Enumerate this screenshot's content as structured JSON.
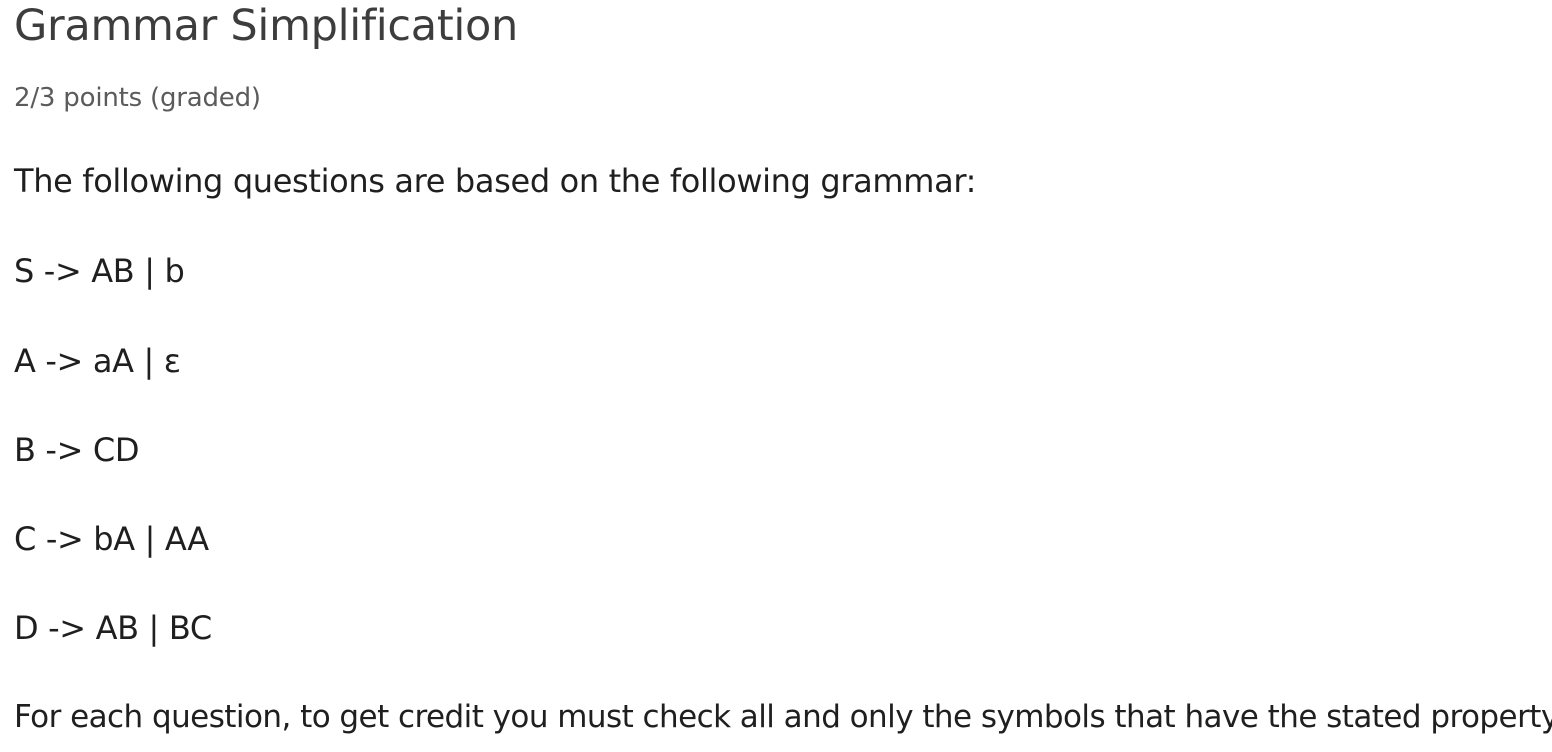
{
  "problem": {
    "title": "Grammar Simplification",
    "points": "2/3 points (graded)",
    "intro": "The following questions are based on the following grammar:",
    "grammar": [
      "S -> AB | b",
      "A -> aA | ε",
      "B -> CD",
      "C -> bA | AA",
      "D -> AB | BC"
    ],
    "instructions": "For each question, to get credit you must check all and only the symbols that have the stated property."
  }
}
